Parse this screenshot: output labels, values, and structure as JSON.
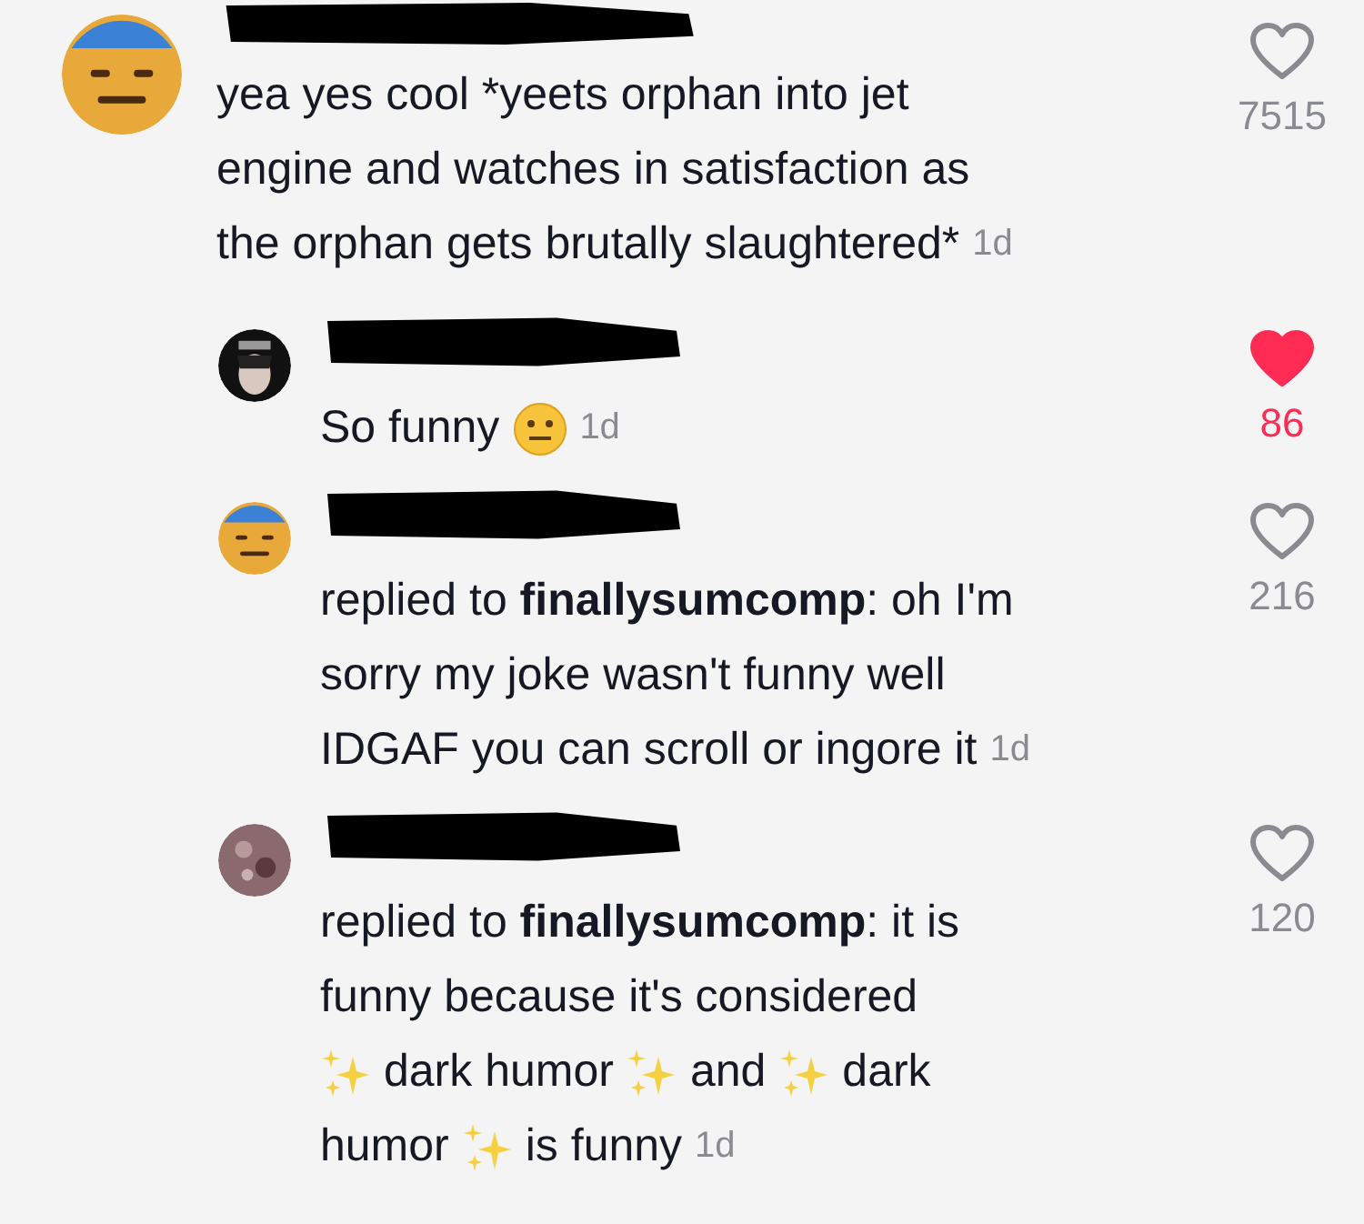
{
  "comments": [
    {
      "liked": false,
      "likes": "7515",
      "time": "1d",
      "lines": [
        [
          {
            "kind": "text",
            "text": "yea yes cool *yeets orphan into jet"
          }
        ],
        [
          {
            "kind": "text",
            "text": "engine and watches in satisfaction as"
          }
        ],
        [
          {
            "kind": "text",
            "text": "the orphan gets brutally slaughtered*"
          }
        ]
      ],
      "children": [
        {
          "liked": true,
          "likes": "86",
          "time": "1d",
          "lines": [
            [
              {
                "kind": "text",
                "text": "So funny"
              },
              {
                "kind": "neutral-face"
              }
            ]
          ]
        },
        {
          "liked": false,
          "likes": "216",
          "time": "1d",
          "lines": [
            [
              {
                "kind": "text",
                "text": "replied to **finallysumcomp**: oh I'm"
              }
            ],
            [
              {
                "kind": "text",
                "text": "sorry my joke wasn't funny well"
              }
            ],
            [
              {
                "kind": "text",
                "text": "IDGAF you can scroll or ingore it"
              }
            ]
          ]
        },
        {
          "liked": false,
          "likes": "120",
          "time": "1d",
          "lines": [
            [
              {
                "kind": "text",
                "text": "replied to **finallysumcomp**: it is"
              }
            ],
            [
              {
                "kind": "text",
                "text": "funny because it's considered"
              }
            ],
            [
              {
                "kind": "sparkles"
              },
              {
                "kind": "text",
                "text": "dark humor"
              },
              {
                "kind": "sparkles"
              },
              {
                "kind": "text",
                "text": "and"
              },
              {
                "kind": "sparkles"
              },
              {
                "kind": "text",
                "text": "dark"
              }
            ],
            [
              {
                "kind": "text",
                "text": "humor"
              },
              {
                "kind": "sparkles"
              },
              {
                "kind": "text",
                "text": "is funny"
              }
            ]
          ]
        }
      ]
    }
  ]
}
